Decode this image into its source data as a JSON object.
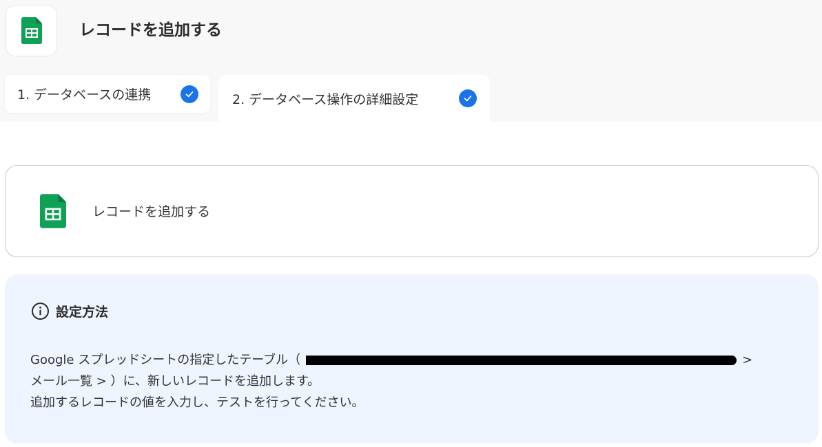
{
  "header": {
    "title": "レコードを追加する",
    "app_icon": "google-sheets-icon"
  },
  "tabs": [
    {
      "label": "1. データベースの連携",
      "completed": true
    },
    {
      "label": "2. データベース操作の詳細設定",
      "completed": true,
      "active": true
    }
  ],
  "action": {
    "label": "レコードを追加する",
    "icon": "google-sheets-icon"
  },
  "info": {
    "icon": "info-icon",
    "title": "設定方法",
    "line1_before": "Google スプレッドシートの指定したテーブル（",
    "line1_after": ">",
    "line2": "メール一覧 > ）に、新しいレコードを追加します。",
    "line3": "追加するレコードの値を入力し、テストを行ってください。"
  },
  "colors": {
    "accent": "#1a73e8",
    "sheets_green": "#0fa155",
    "info_bg": "#eef5fe"
  }
}
